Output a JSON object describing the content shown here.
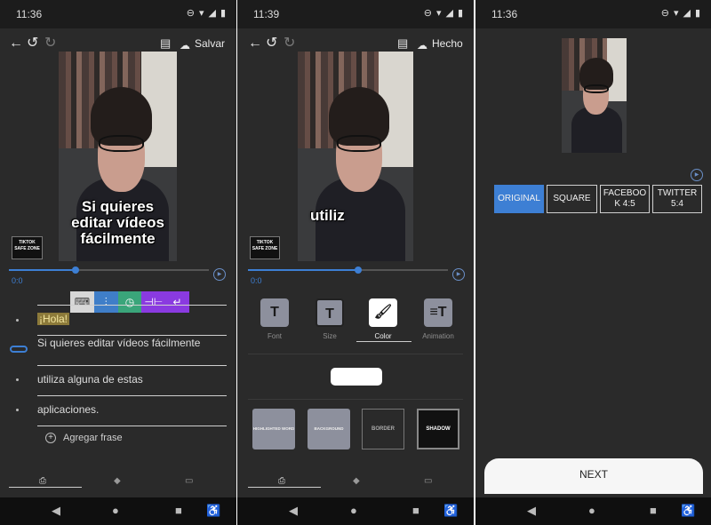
{
  "panels": [
    {
      "status_time": "11:36",
      "action_label": "Salvar",
      "caption": "Si quieres editar vídeos fácilmente",
      "safe_zone": "TIKTOK SAFE ZONE",
      "time_label": "0:0",
      "phrases": [
        "¡Hola!",
        "Si quieres editar vídeos fácilmente",
        "utiliza alguna de estas",
        "aplicaciones."
      ],
      "add_phrase": "Agregar frase"
    },
    {
      "status_time": "11:39",
      "action_label": "Hecho",
      "caption": "utiliz",
      "safe_zone": "TIKTOK SAFE ZONE",
      "time_label": "0:0",
      "tools": [
        {
          "icon": "T",
          "label": "Font"
        },
        {
          "icon": "T",
          "label": "Size"
        },
        {
          "icon": "🖌",
          "label": "Color"
        },
        {
          "icon": "≡T",
          "label": "Animation"
        }
      ],
      "styles": [
        "HIGHLIGHTED WORD",
        "BACKGROUND",
        "BORDER",
        "SHADOW"
      ]
    },
    {
      "status_time": "11:36",
      "ratios": [
        "ORIGINAL",
        "SQUARE",
        "FACEBOO K 4:5",
        "TWITTER 5:4"
      ],
      "next_label": "NEXT"
    }
  ],
  "colors": {
    "accent": "#3d7fd4",
    "panel_bg": "#2a2a2a",
    "toolbar_keyboard": "#d7d7d7",
    "toolbar_adjust": "#3f7ec8",
    "toolbar_timer": "#3aa57a",
    "toolbar_split": "#8a3ae0",
    "toolbar_enter": "#8a3ae0"
  },
  "toolbar_icons": [
    "keyboard-icon",
    "sliders-icon",
    "clock-icon",
    "split-icon",
    "enter-icon"
  ]
}
